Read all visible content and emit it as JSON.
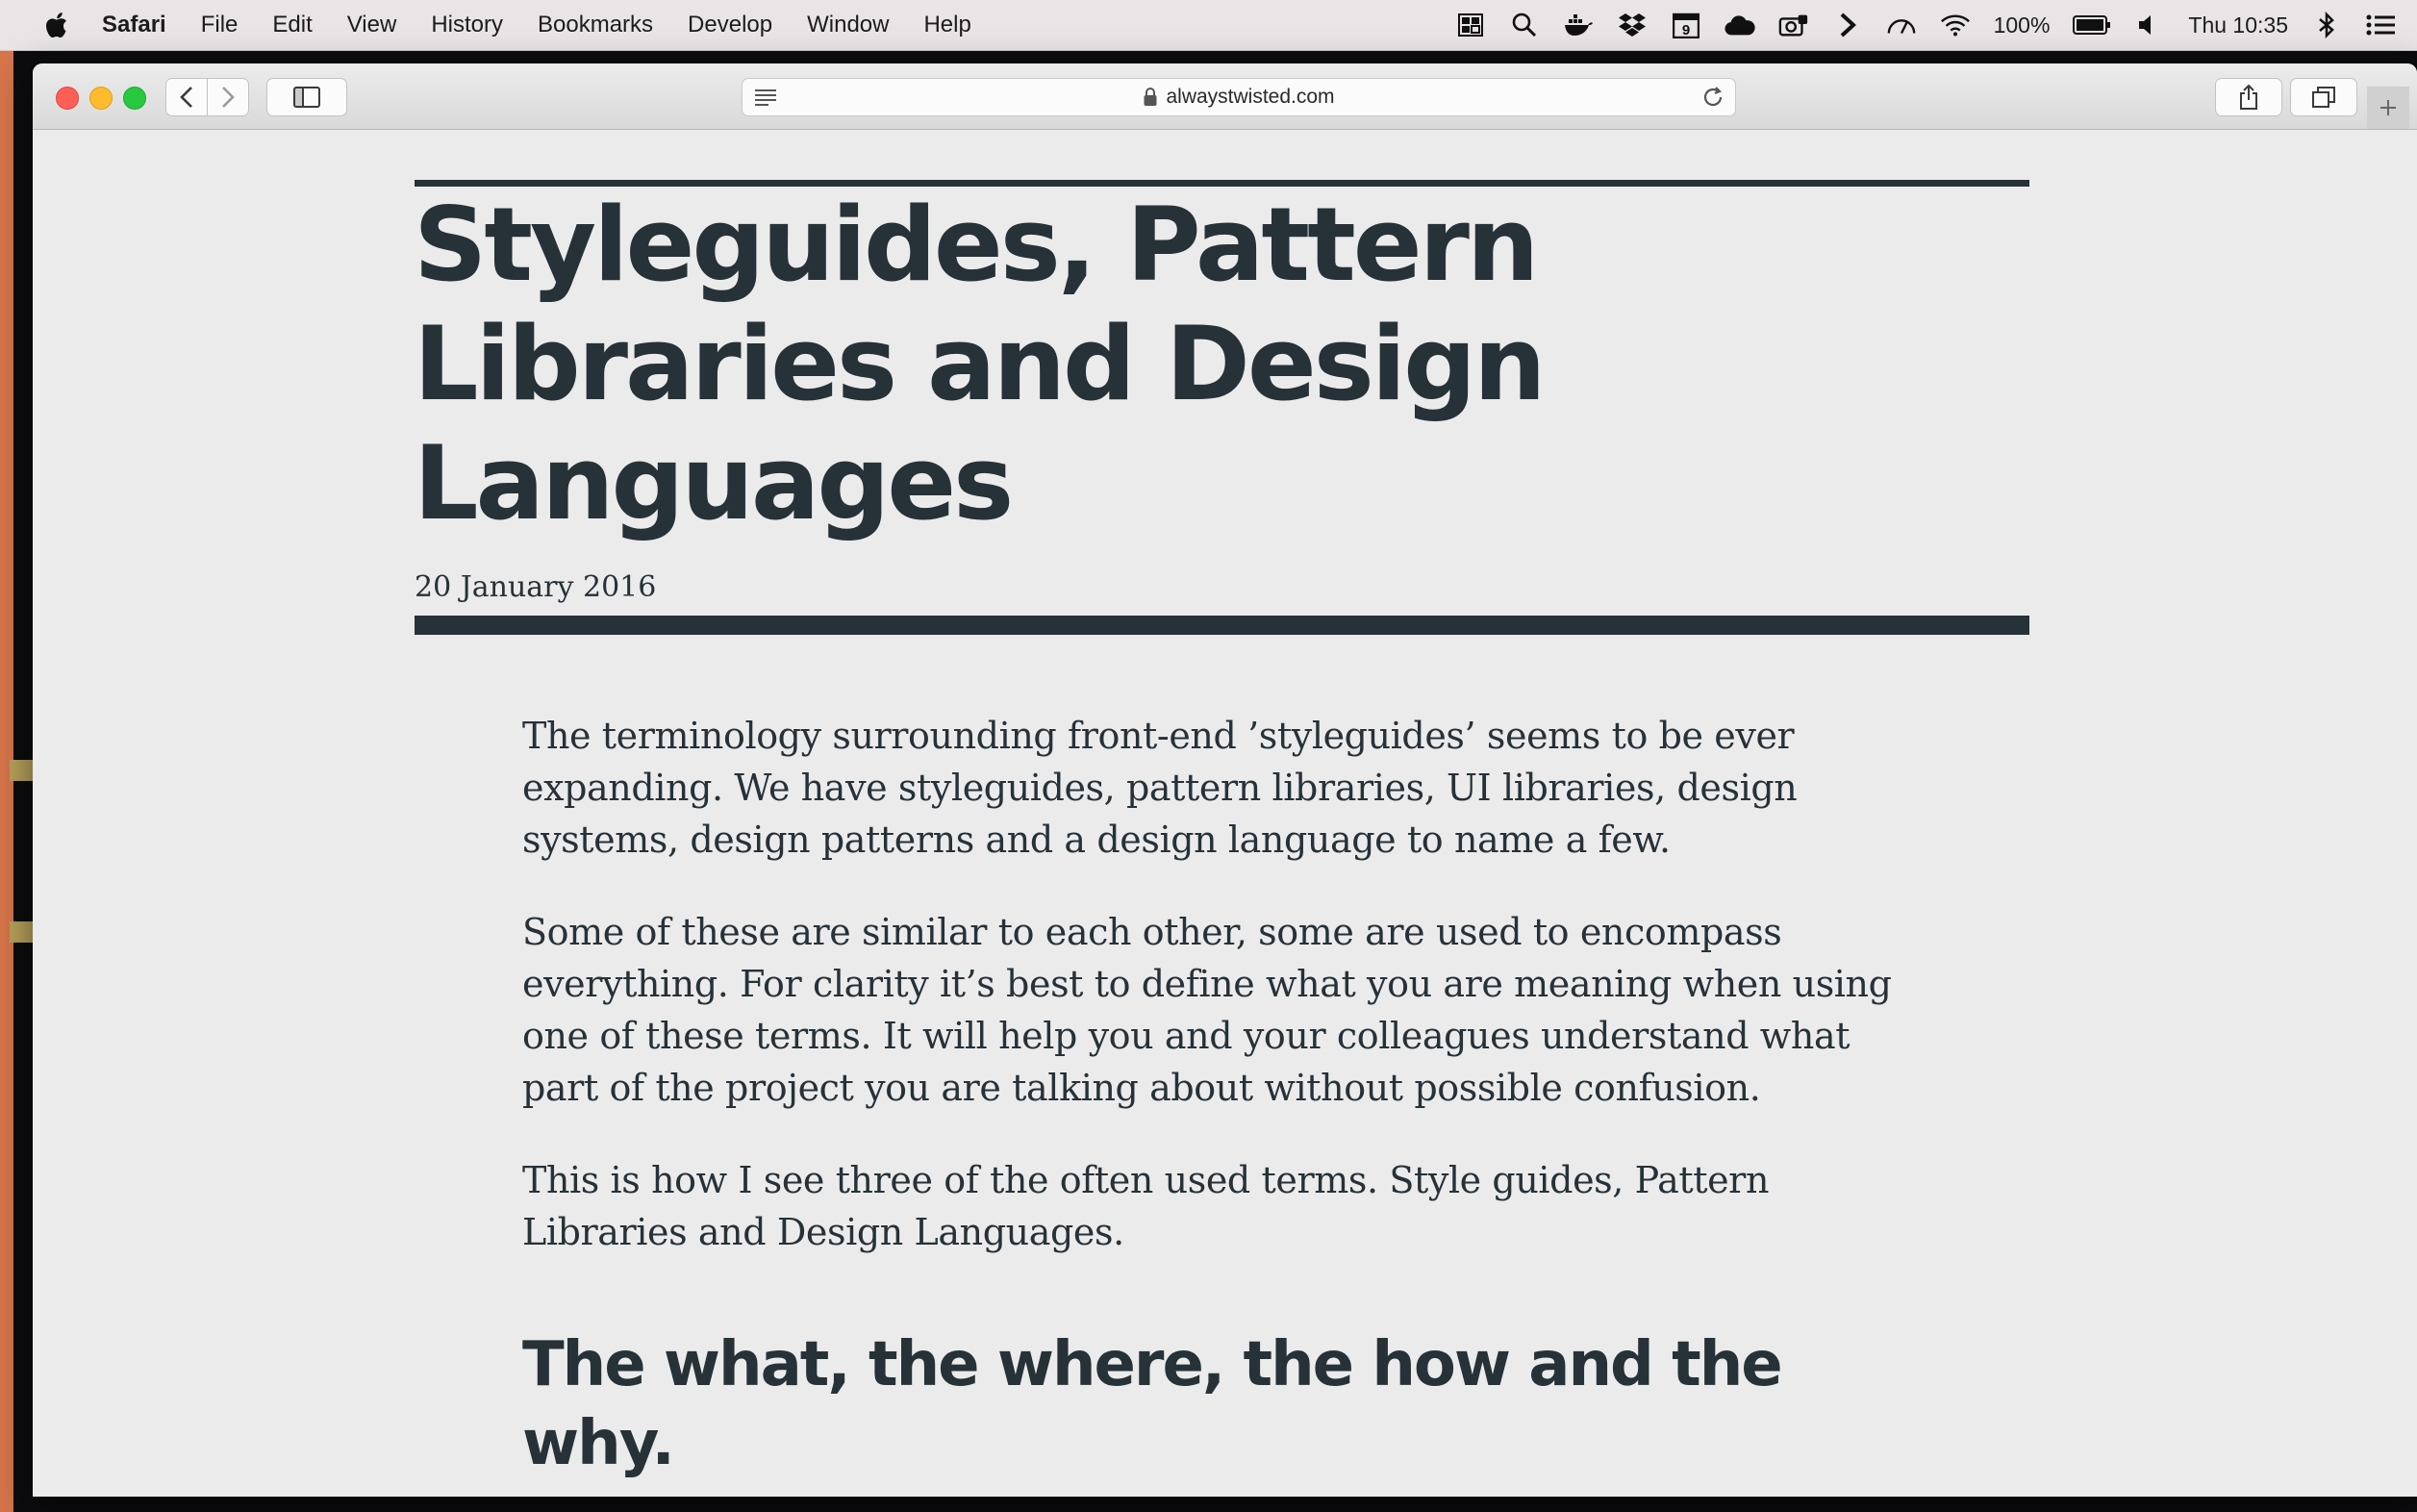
{
  "menubar": {
    "app_name": "Safari",
    "items": [
      "File",
      "Edit",
      "View",
      "History",
      "Bookmarks",
      "Develop",
      "Window",
      "Help"
    ],
    "status": {
      "battery": "100%",
      "clock": "Thu 10:35",
      "calendar_day": "9"
    }
  },
  "browser": {
    "url": "alwaystwisted.com"
  },
  "article": {
    "title": "Styleguides, Pattern Libraries and Design Languages",
    "date": "20 January 2016",
    "paragraphs": [
      "The terminology surrounding front-end ’styleguides’ seems to be ever expanding. We have styleguides, pattern libraries, UI libraries, design systems, design patterns and a design language to name a few.",
      "Some of these are similar to each other, some are used to encompass everything. For clarity it’s best to define what you are meaning when using one of these terms. It will help you and your colleagues understand what part of the project you are talking about without possible confusion.",
      "This is how I see three of the often used terms. Style guides, Pattern Libraries and Design Languages."
    ],
    "subheading": "The what, the where, the how and the why."
  },
  "colors": {
    "text": "#263238",
    "page_background": "#ebebeb",
    "wallpaper_accent": "#d7754a"
  }
}
